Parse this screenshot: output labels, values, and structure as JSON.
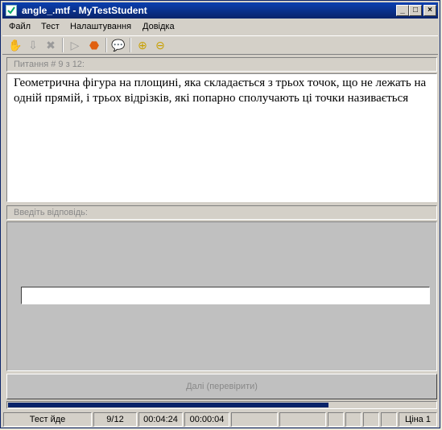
{
  "window": {
    "title": "angle_.mtf - MyTestStudent"
  },
  "titlebar_buttons": {
    "minimize": "_",
    "maximize": "□",
    "close": "×"
  },
  "menu": {
    "items": [
      "Файл",
      "Тест",
      "Налаштування",
      "Довідка"
    ]
  },
  "toolbar": {
    "icons": [
      "hand-icon",
      "arrow-down-icon",
      "stop-x-icon",
      "play-icon",
      "stop-hexagon-icon",
      "chat-icon",
      "zoom-in-icon",
      "zoom-out-icon"
    ]
  },
  "question": {
    "header": "Питання # 9 з 12:",
    "text": "Геометрична фігура на площині, яка складається з трьох точок, що не лежать на одній прямій, і трьох відрізків, які попарно сполучають ці точки називається"
  },
  "answer": {
    "header": "Введіть відповідь:",
    "value": ""
  },
  "next_button": {
    "label": "Далі (перевірити)"
  },
  "progress": {
    "fraction": 0.75
  },
  "status": {
    "state": "Тест йде",
    "counter": "9/12",
    "elapsed": "00:04:24",
    "question_time": "00:00:04",
    "price": "Ціна 1"
  },
  "colors": {
    "titlebar": "#0a246a",
    "progress": "#0a246a",
    "stop_icon": "#e06010"
  }
}
